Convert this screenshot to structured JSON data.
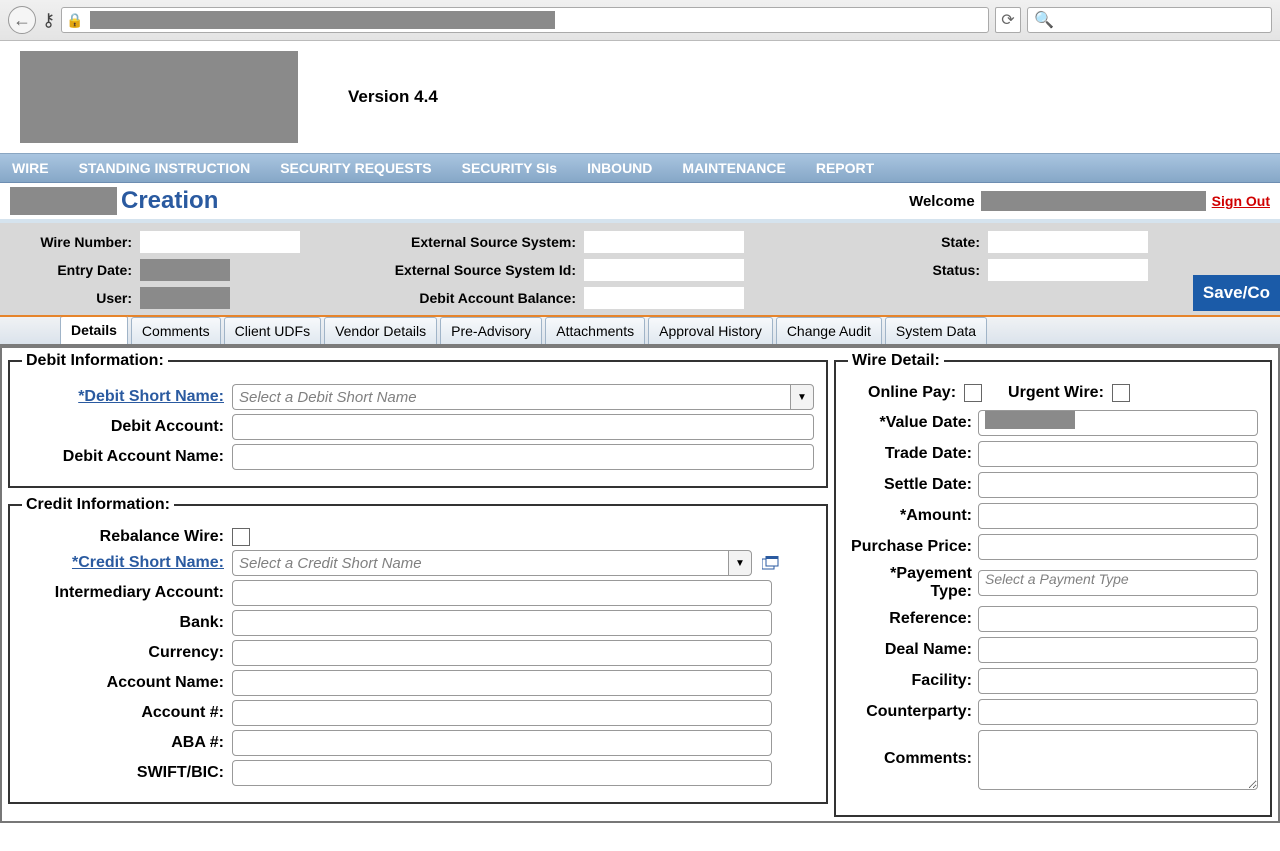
{
  "browser": {
    "reload_glyph": "⟳",
    "search_glyph": "🔍"
  },
  "app": {
    "version_label": "Version 4.4"
  },
  "nav": {
    "items": [
      "WIRE",
      "STANDING INSTRUCTION",
      "SECURITY REQUESTS",
      "SECURITY SIs",
      "INBOUND",
      "MAINTENANCE",
      "REPORT"
    ]
  },
  "titlebar": {
    "page_title": "Creation",
    "welcome_label": "Welcome",
    "signout_label": "Sign Out"
  },
  "header_fields": {
    "wire_number_label": "Wire Number:",
    "entry_date_label": "Entry Date:",
    "user_label": "User:",
    "ext_src_label": "External Source System:",
    "ext_src_id_label": "External Source System Id:",
    "debit_balance_label": "Debit Account Balance:",
    "state_label": "State:",
    "status_label": "Status:",
    "save_button": "Save/Co"
  },
  "tabs": [
    "Details",
    "Comments",
    "Client UDFs",
    "Vendor Details",
    "Pre-Advisory",
    "Attachments",
    "Approval History",
    "Change Audit",
    "System Data"
  ],
  "active_tab": "Details",
  "debit": {
    "legend": "Debit Information:",
    "short_name_label": "*Debit Short Name:",
    "short_name_placeholder": "Select a Debit Short Name",
    "account_label": "Debit Account:",
    "account_name_label": "Debit Account Name:"
  },
  "credit": {
    "legend": "Credit Information:",
    "rebalance_label": "Rebalance Wire:",
    "short_name_label": "*Credit Short Name:",
    "short_name_placeholder": "Select a Credit Short Name",
    "intermediary_label": "Intermediary Account:",
    "bank_label": "Bank:",
    "currency_label": "Currency:",
    "account_name_label": "Account Name:",
    "account_num_label": "Account #:",
    "aba_label": "ABA #:",
    "swift_label": "SWIFT/BIC:"
  },
  "wire_detail": {
    "legend": "Wire Detail:",
    "online_pay_label": "Online Pay:",
    "urgent_label": "Urgent Wire:",
    "value_date_label": "*Value Date:",
    "trade_date_label": "Trade Date:",
    "settle_date_label": "Settle Date:",
    "amount_label": "*Amount:",
    "purchase_price_label": "Purchase Price:",
    "payment_type_label": "*Payement Type:",
    "payment_type_placeholder": "Select a Payment Type",
    "reference_label": "Reference:",
    "deal_name_label": "Deal Name:",
    "facility_label": "Facility:",
    "counterparty_label": "Counterparty:",
    "comments_label": "Comments:"
  }
}
